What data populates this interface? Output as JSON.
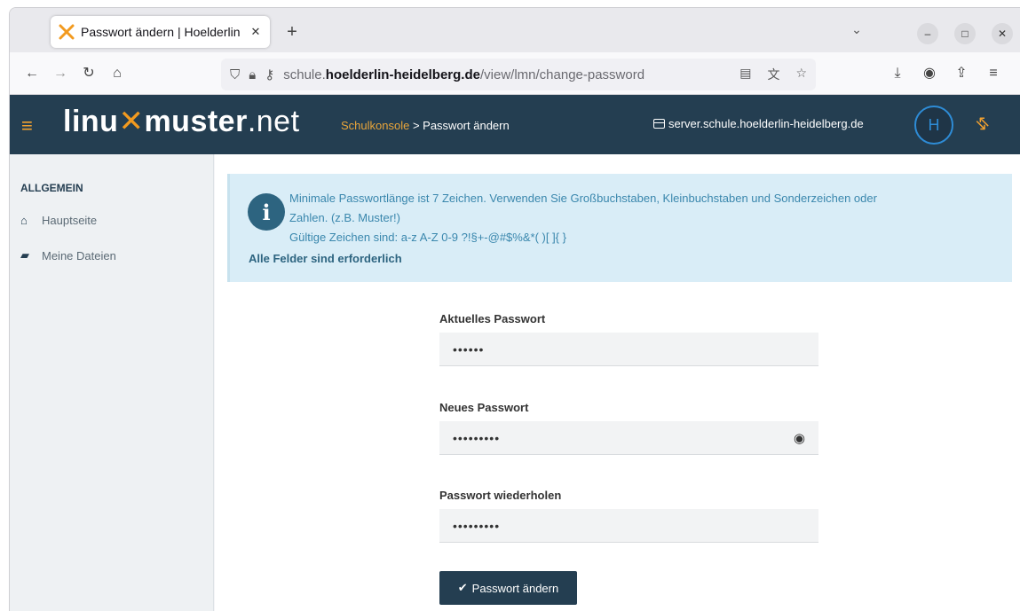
{
  "browser": {
    "tab_title": "Passwort ändern | Hoelderlin",
    "tab_close": "✕",
    "new_tab": "+",
    "tab_list": "⌄",
    "window_minimize": "–",
    "window_maximize": "□",
    "window_close": "✕",
    "url_prefix": "schule.",
    "url_host": "hoelderlin-heidelberg.de",
    "url_path": "/view/lmn/change-password",
    "icons": [
      "back-icon",
      "forward-icon",
      "reload-icon",
      "home-icon",
      "shield-icon",
      "lock-icon",
      "key-icon",
      "reader-icon",
      "translate-icon",
      "bookmark-star-icon",
      "download-icon",
      "account-icon",
      "share-icon",
      "menu-icon"
    ]
  },
  "app": {
    "logo_part1": "linu",
    "logo_x": "✕",
    "logo_part2": "muster",
    "logo_part3": ".net",
    "breadcrumb_root": "Schulkonsole",
    "breadcrumb_sep": " > ",
    "breadcrumb_current": "Passwort ändern",
    "server_name": "server.schule.hoelderlin-heidelberg.de",
    "avatar_letter": "H",
    "accent_color": "#f29a1f",
    "header_color": "#243e51"
  },
  "sidebar": {
    "section_heading": "ALLGEMEIN",
    "items": [
      {
        "label": "Hauptseite",
        "icon": "home-icon"
      },
      {
        "label": "Meine Dateien",
        "icon": "folder-icon"
      }
    ]
  },
  "alert": {
    "line1": "Minimale Passwortlänge ist 7 Zeichen. Verwenden Sie Großbuchstaben, Kleinbuchstaben und Sonderzeichen oder",
    "line2": "Zahlen. (z.B. Muster!)",
    "line3": "Gültige Zeichen sind: a-z A-Z 0-9 ?!§+-@#$%&*( )[ ]{ }",
    "required_note": "Alle Felder sind erforderlich"
  },
  "form": {
    "current_label": "Aktuelles Passwort",
    "current_value": "••••••",
    "new_label": "Neues Passwort",
    "new_value": "•••••••••",
    "repeat_label": "Passwort wiederholen",
    "repeat_value": "•••••••••",
    "submit_label": "Passwort ändern"
  }
}
